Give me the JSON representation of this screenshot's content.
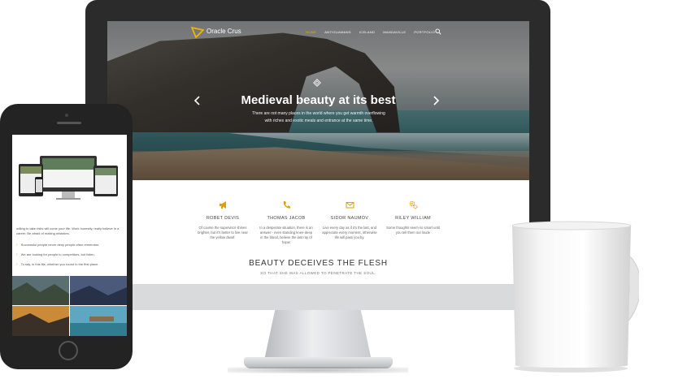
{
  "site": {
    "brand": "Oracle Crus",
    "nav": [
      {
        "label": "HOME",
        "active": true
      },
      {
        "label": "ANTIGUAMANS",
        "active": false
      },
      {
        "label": "ICELAND",
        "active": false
      },
      {
        "label": "MANDAVILLE",
        "active": false
      },
      {
        "label": "PORTFOLIO",
        "active": false
      }
    ],
    "hero": {
      "title": "Medieval beauty at its best",
      "subtitle": "There are not many places in the world where you get warmth overflowing with riches and exotic meals and entrance at the same time."
    },
    "features": [
      {
        "icon": "megaphone-icon",
        "name": "ROBET DEVIS",
        "text": "Of course the supervisor shines brighter, but it's better to live near the yellow dwarf."
      },
      {
        "icon": "phone-icon",
        "name": "THOMAS JACOB",
        "text": "In a desperate situation, there is an answer - even standing knee-deep in the blood, believe the last ray of hope!"
      },
      {
        "icon": "envelope-icon",
        "name": "SIDOR NAUMOV",
        "text": "Live every day as if it's the last, and appreciate every moment, otherwise life will pass you by."
      },
      {
        "icon": "gears-icon",
        "name": "RILEY WILLIAM",
        "text": "Some thoughts seem so smart until you tell them out loude"
      }
    ],
    "section": {
      "title": "BEAUTY DECEIVES THE FLESH",
      "subtitle": "SO THAT SHE WAS ALLOWED TO PENETRATE THE SOUL."
    }
  },
  "phone": {
    "intro": "willing to take risks will come your life. Work honestly, really believe in a career. Be afraid of making mistakes.",
    "items": [
      "Successful people never deny people often remember.",
      "We are looking for people to competitors, but listen.",
      "To say, in this life, whether you round in the first place."
    ]
  },
  "colors": {
    "accent": "#f0b400",
    "bezel": "#2b2b2b"
  }
}
